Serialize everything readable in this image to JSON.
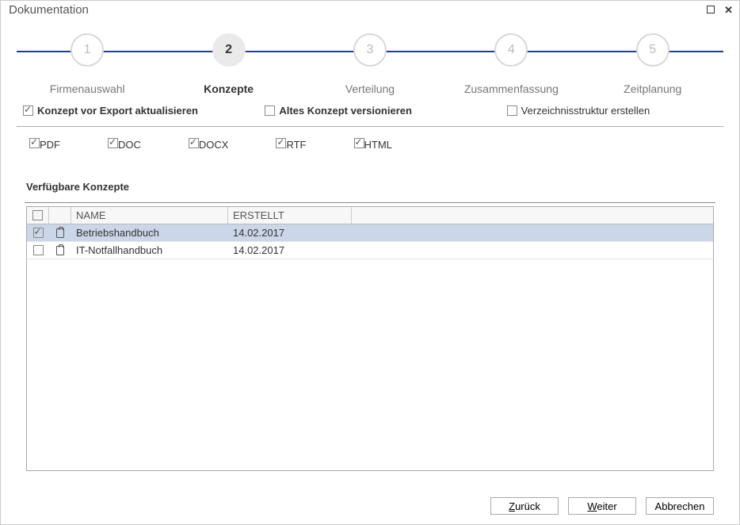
{
  "window": {
    "title": "Dokumentation"
  },
  "stepper": {
    "steps": [
      {
        "num": "1",
        "label": "Firmenauswahl"
      },
      {
        "num": "2",
        "label": "Konzepte"
      },
      {
        "num": "3",
        "label": "Verteilung"
      },
      {
        "num": "4",
        "label": "Zusammenfassung"
      },
      {
        "num": "5",
        "label": "Zeitplanung"
      }
    ],
    "activeIndex": 1
  },
  "options": {
    "updateBeforeExport": {
      "label": "Konzept vor Export aktualisieren",
      "checked": true
    },
    "versionOld": {
      "label": "Altes Konzept versionieren",
      "checked": false
    },
    "createDirStructure": {
      "label": "Verzeichnisstruktur erstellen",
      "checked": false
    }
  },
  "formats": {
    "pdf": {
      "label": "PDF",
      "checked": true
    },
    "doc": {
      "label": "DOC",
      "checked": true
    },
    "docx": {
      "label": "DOCX",
      "checked": true
    },
    "rtf": {
      "label": "RTF",
      "checked": true
    },
    "html": {
      "label": "HTML",
      "checked": true
    }
  },
  "section": {
    "available": "Verfügbare Konzepte"
  },
  "table": {
    "columns": {
      "name": "NAME",
      "created": "ERSTELLT"
    },
    "rows": [
      {
        "checked": true,
        "name": "Betriebshandbuch",
        "created": "14.02.2017",
        "selected": true
      },
      {
        "checked": false,
        "name": "IT-Notfallhandbuch",
        "created": "14.02.2017",
        "selected": false
      }
    ]
  },
  "footer": {
    "back": "Zurück",
    "next": "Weiter",
    "cancel": "Abbrechen"
  }
}
